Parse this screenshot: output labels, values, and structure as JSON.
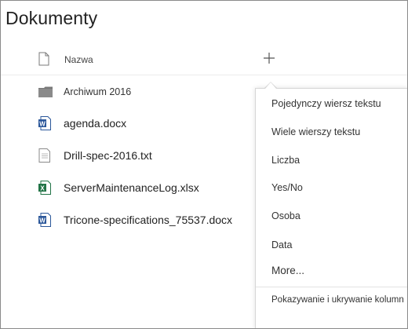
{
  "page": {
    "title": "Dokumenty"
  },
  "header": {
    "name_label": "Nazwa"
  },
  "files": [
    {
      "name": "Archiwum 2016",
      "type": "folder"
    },
    {
      "name": "agenda.docx",
      "type": "word"
    },
    {
      "name": "Drill-spec-2016.txt",
      "type": "text"
    },
    {
      "name": "ServerMaintenanceLog.xlsx",
      "type": "excel"
    },
    {
      "name": "Tricone-specifications_75537.docx",
      "type": "word"
    }
  ],
  "menu": {
    "items": [
      "Pojedynczy wiersz tekstu",
      "Wiele wierszy tekstu",
      "Liczba",
      "Yes/No",
      "Osoba",
      "Data"
    ],
    "more": "More...",
    "footer": "Pokazywanie i ukrywanie kolumn"
  },
  "colors": {
    "word": "#2b579a",
    "excel": "#217346",
    "folder": "#7a7a7a"
  },
  "icons": {
    "add_column": "plus-icon",
    "file_header": "document-icon"
  }
}
